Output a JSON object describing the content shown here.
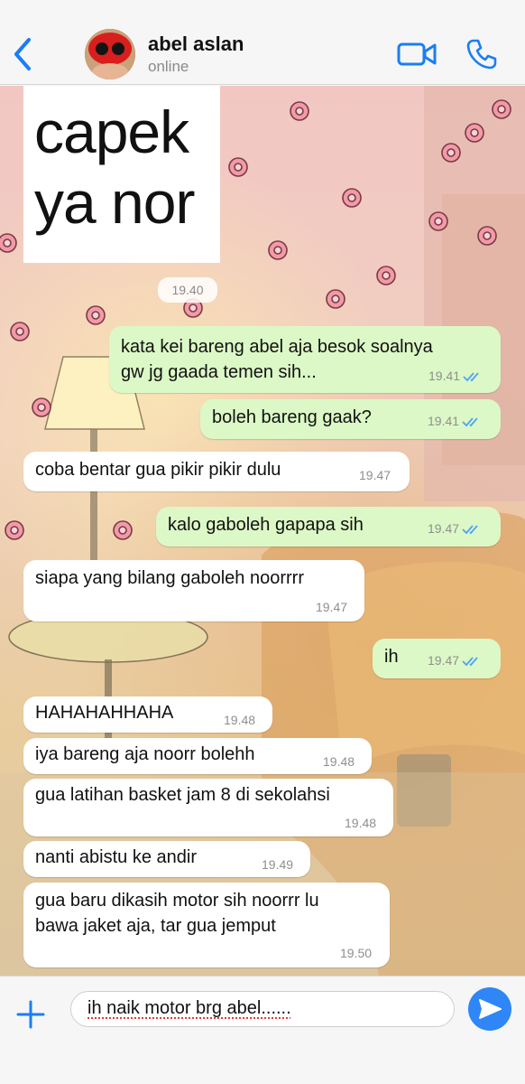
{
  "header": {
    "back_icon": "chevron-left-icon",
    "contact_name": "abel aslan",
    "status": "online",
    "accent_color": "#1a7ef3"
  },
  "sticker": {
    "lines": [
      "capek",
      "ya nor"
    ]
  },
  "first_time": "19.40",
  "messages": [
    {
      "dir": "out",
      "text": "kata kei bareng abel aja besok soalnya\ngw jg gaada temen sih...",
      "time": "19.41",
      "read": true
    },
    {
      "dir": "out",
      "text": "boleh bareng gaak?",
      "time": "19.41",
      "read": true
    },
    {
      "dir": "in",
      "text": "coba bentar gua pikir pikir dulu",
      "time": "19.47"
    },
    {
      "dir": "out",
      "text": "kalo gaboleh gapapa sih",
      "time": "19.47",
      "read": true
    },
    {
      "dir": "in",
      "text": "siapa yang bilang gaboleh noorrrr",
      "time": "19.47"
    },
    {
      "dir": "out",
      "text": "ih",
      "time": "19.47",
      "read": true
    },
    {
      "dir": "in",
      "text": "HAHAHAHHAHA",
      "time": "19.48"
    },
    {
      "dir": "in",
      "text": "iya bareng aja noorr bolehh",
      "time": "19.48"
    },
    {
      "dir": "in",
      "text": "gua latihan basket jam 8 di sekolahsi",
      "time": "19.48"
    },
    {
      "dir": "in",
      "text": "nanti abistu ke andir",
      "time": "19.49"
    },
    {
      "dir": "in",
      "text": "gua baru dikasih motor sih noorrr lu\nbawa jaket aja, tar gua jemput",
      "time": "19.50"
    }
  ],
  "composer": {
    "value": "ih naik motor brg abel......"
  },
  "colors": {
    "outgoing_bubble": "#dcf8c6",
    "incoming_bubble": "#ffffff",
    "read_ticks": "#4fa3f7",
    "send_button": "#2f86f6"
  }
}
